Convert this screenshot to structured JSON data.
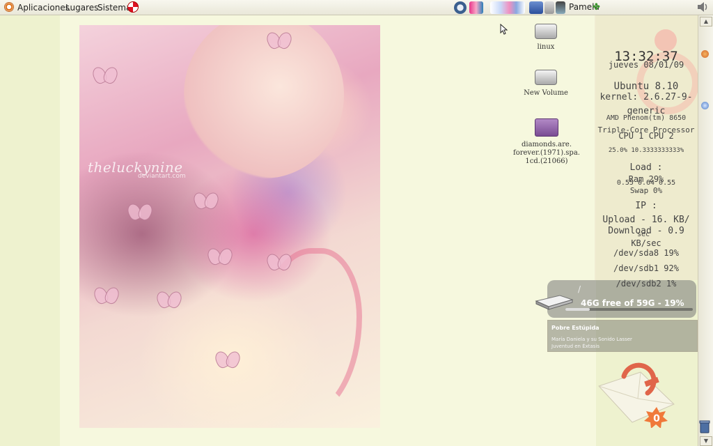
{
  "panel": {
    "menus": [
      "Aplicaciones",
      "Lugares",
      "Sistema"
    ],
    "user_name": "Pamela",
    "icons": [
      "ubuntu-logo-icon",
      "help-icon",
      "network-icon",
      "volume-icon",
      "clover-icon"
    ]
  },
  "wallpaper": {
    "watermark": "theluckynine",
    "watermark_sub": "deviantart.com"
  },
  "desktop_icons": [
    {
      "label": "linux",
      "icon": "drive-icon"
    },
    {
      "label": "New Volume",
      "icon": "drive-icon"
    },
    {
      "label_lines": [
        "diamonds.are.",
        "forever.(1971).spa.",
        "1cd.(21066)"
      ],
      "icon": "folder-icon"
    }
  ],
  "conky": {
    "time": "13:32:37",
    "date": "jueves 08/01/09",
    "os": "Ubuntu 8.10",
    "kernel_line1": "kernel: 2.6.27-9-",
    "kernel_line2": "generic",
    "cpu_model_line1": "AMD Phenom(tm) 8650",
    "cpu_model_line2": "Triple-Core Processor",
    "cpu_labels": "CPU 1   CPU 2",
    "cpu_values": "25.0% 10.3333333333%",
    "load_label": "Load :",
    "ram": "Ram 29%",
    "load_values": "0.55 0.64 0.55",
    "swap": "Swap 0%",
    "ip": "IP :",
    "upload": "Upload - 16. KB/",
    "upload_unit": "sec",
    "download": "Download - 0.9",
    "download_unit": "KB/sec",
    "disk1": "/dev/sda8 19%",
    "disk2": "/dev/sdb1 92%",
    "disk3": "/dev/sdb2 1%"
  },
  "usb_notification": {
    "slash": "/",
    "free_text": "46G free of 59G - 19%",
    "used_fraction": 0.19
  },
  "music_notification": {
    "title": "Pobre Estúpida",
    "artist": "María Daniela y su Sonido Lasser",
    "album": "Juventud en Éxtasis"
  },
  "mail_widget": {
    "count": "0"
  },
  "colors": {
    "desktop_bg": "#eef2cf",
    "panel_bg": "#f2f0e4",
    "notification_bg": "#808080"
  }
}
